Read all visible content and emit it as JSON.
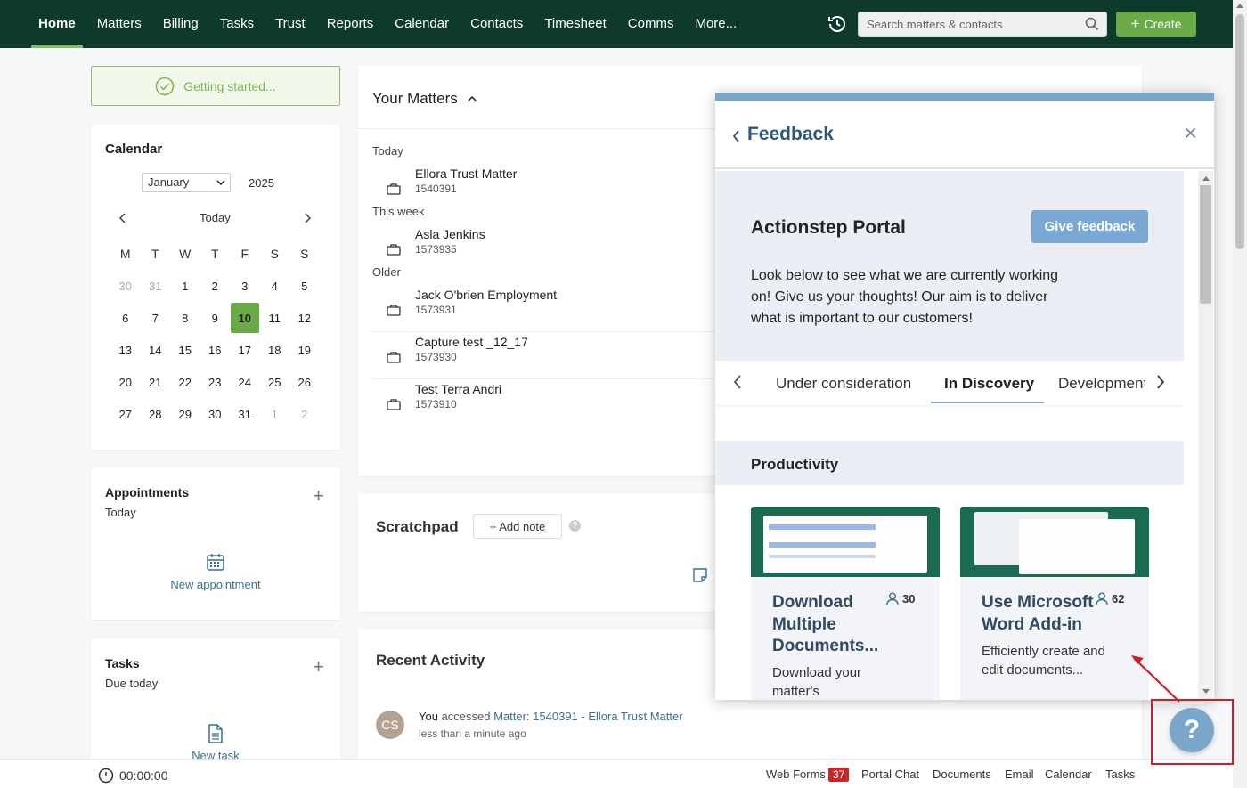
{
  "nav": {
    "items": [
      "Home",
      "Matters",
      "Billing",
      "Tasks",
      "Trust",
      "Reports",
      "Calendar",
      "Contacts",
      "Timesheet",
      "Comms",
      "More..."
    ],
    "active": "Home"
  },
  "search": {
    "placeholder": "Search matters & contacts"
  },
  "create": {
    "label": "Create"
  },
  "getting_started": {
    "label": "Getting started..."
  },
  "calendar": {
    "title": "Calendar",
    "month": "January",
    "year": "2025",
    "today_label": "Today",
    "weekdays": [
      "M",
      "T",
      "W",
      "T",
      "F",
      "S",
      "S"
    ],
    "days": [
      [
        "30",
        "31",
        "1",
        "2",
        "3",
        "4",
        "5"
      ],
      [
        "6",
        "7",
        "8",
        "9",
        "10",
        "11",
        "12"
      ],
      [
        "13",
        "14",
        "15",
        "16",
        "17",
        "18",
        "19"
      ],
      [
        "20",
        "21",
        "22",
        "23",
        "24",
        "25",
        "26"
      ],
      [
        "27",
        "28",
        "29",
        "30",
        "31",
        "1",
        "2"
      ]
    ],
    "selected": "10"
  },
  "appointments": {
    "title": "Appointments",
    "subtitle": "Today",
    "new_label": "New appointment"
  },
  "tasks": {
    "title": "Tasks",
    "subtitle": "Due today",
    "new_label": "New task"
  },
  "matters": {
    "title": "Your Matters",
    "groups": [
      {
        "label": "Today",
        "items": [
          {
            "name": "Ellora Trust Matter",
            "id": "1540391"
          }
        ]
      },
      {
        "label": "This week",
        "items": [
          {
            "name": "Asla Jenkins",
            "id": "1573935"
          }
        ]
      },
      {
        "label": "Older",
        "items": [
          {
            "name": "Jack O'brien Employment",
            "id": "1573931"
          },
          {
            "name": "Capture test _12_17",
            "id": "1573930"
          },
          {
            "name": "Test Terra Andri",
            "id": "1573910"
          }
        ]
      }
    ]
  },
  "scratchpad": {
    "title": "Scratchpad",
    "add_note": "+ Add note",
    "help": "?"
  },
  "recent": {
    "title": "Recent Activity",
    "avatar": "CS",
    "actor": "You",
    "verb": "accessed",
    "link": "Matter: 1540391 - Ellora Trust Matter",
    "time": "less than a minute ago"
  },
  "bottom": {
    "timer": "00:00:00",
    "links": [
      "Web Forms",
      "Portal Chat",
      "Documents",
      "Email",
      "Calendar",
      "Tasks"
    ],
    "webforms_count": "37"
  },
  "feedback": {
    "title": "Feedback",
    "portal_title": "Actionstep Portal",
    "give_feedback": "Give feedback",
    "intro": "Look below to see what we are currently working on! Give us your thoughts! Our aim is to deliver what is important to our customers!",
    "tabs": [
      "Under consideration",
      "In Discovery",
      "Development"
    ],
    "active_tab": "In Discovery",
    "section": "Productivity",
    "cards": [
      {
        "title": "Download Multiple Documents...",
        "votes": "30",
        "desc": "Download your matter's"
      },
      {
        "title": "Use Microsoft Word Add-in",
        "votes": "62",
        "desc": "Efficiently create and edit documents..."
      }
    ]
  },
  "help": {
    "label": "?"
  },
  "colors": {
    "nav_bg": "#0e3a2a",
    "accent_green": "#6aab47",
    "feedback_blue": "#7aa7d4",
    "highlight_red": "#cc1f2a"
  }
}
